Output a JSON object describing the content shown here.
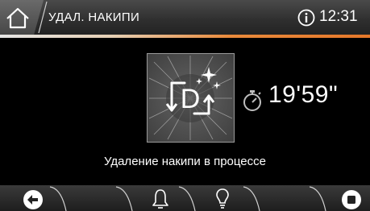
{
  "header": {
    "title": "УДАЛ. НАКИПИ",
    "clock": "12:31",
    "icons": [
      "home-icon",
      "info-icon"
    ]
  },
  "program": {
    "letter": "D",
    "icon": "descaling-program-icon"
  },
  "timer": {
    "icon": "stopwatch-icon",
    "remaining": "19'59\""
  },
  "status": {
    "message": "Удаление накипи в процессе"
  },
  "bottom_bar": {
    "buttons": [
      "back-icon",
      "bell-icon",
      "light-bulb-icon",
      "stop-icon"
    ]
  },
  "colors": {
    "accent": "#e6782a",
    "background": "#000000",
    "text": "#ffffff"
  }
}
